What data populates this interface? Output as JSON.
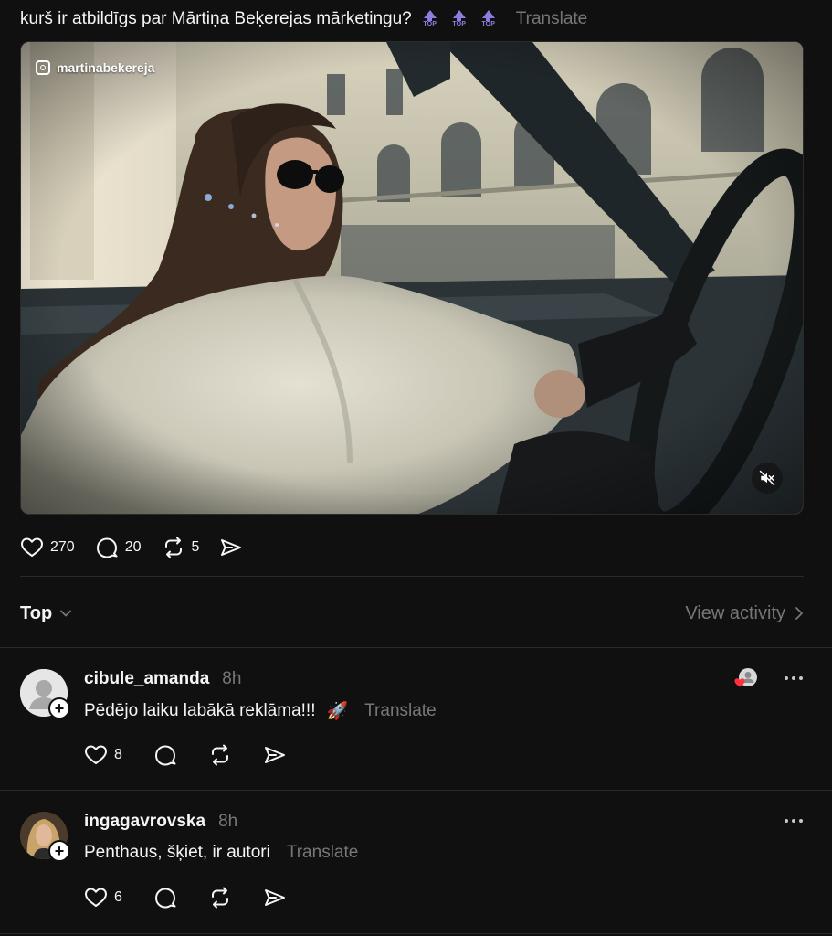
{
  "post": {
    "caption": "kurš ir atbildīgs par Mārtiņa Beķerejas mārketingu?",
    "emoji_label": "TOP",
    "translate": "Translate",
    "video": {
      "watermark_handle": "martinabekereja",
      "muted": true
    },
    "stats": {
      "likes": "270",
      "replies": "20",
      "reposts": "5"
    }
  },
  "sort": {
    "label": "Top",
    "view_activity": "View activity"
  },
  "comments": [
    {
      "username": "cibule_amanda",
      "time": "8h",
      "text": "Pēdējo laiku labākā reklāma!!!",
      "emoji": "🚀",
      "translate": "Translate",
      "likes": "8",
      "liked_by_author": true
    },
    {
      "username": "ingagavrovska",
      "time": "8h",
      "text": "Penthaus, šķiet, ir autori",
      "translate": "Translate",
      "likes": "6",
      "liked_by_author": false
    }
  ],
  "colors": {
    "background": "#101010",
    "text": "#f3f5f7",
    "muted": "#777777",
    "divider": "#2a2a2a",
    "top_emoji": "#8a7fe0",
    "heart_badge": "#ff3040"
  }
}
